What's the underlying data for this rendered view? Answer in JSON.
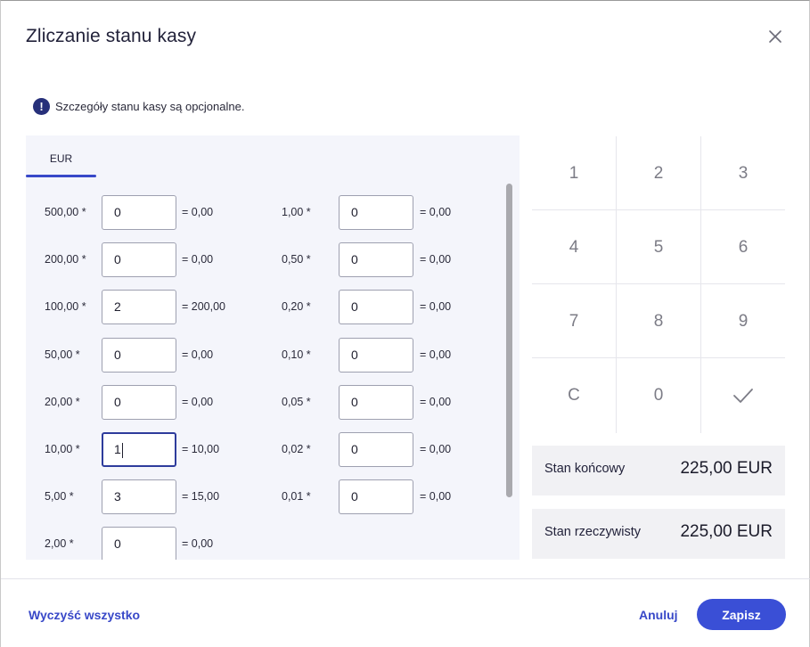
{
  "dialog": {
    "title": "Zliczanie stanu kasy",
    "info_text": "Szczegóły stanu kasy są opcjonalne."
  },
  "tabs": [
    {
      "label": "EUR",
      "active": true
    }
  ],
  "denominations_left": [
    {
      "label": "500,00 *",
      "value": "0",
      "result": "= 0,00"
    },
    {
      "label": "200,00 *",
      "value": "0",
      "result": "= 0,00"
    },
    {
      "label": "100,00 *",
      "value": "2",
      "result": "= 200,00"
    },
    {
      "label": "50,00 *",
      "value": "0",
      "result": "= 0,00"
    },
    {
      "label": "20,00 *",
      "value": "0",
      "result": "= 0,00"
    },
    {
      "label": "10,00 *",
      "value": "1",
      "result": "= 10,00",
      "focused": true
    },
    {
      "label": "5,00 *",
      "value": "3",
      "result": "= 15,00"
    },
    {
      "label": "2,00 *",
      "value": "0",
      "result": "= 0,00"
    }
  ],
  "denominations_right": [
    {
      "label": "1,00 *",
      "value": "0",
      "result": "= 0,00"
    },
    {
      "label": "0,50 *",
      "value": "0",
      "result": "= 0,00"
    },
    {
      "label": "0,20 *",
      "value": "0",
      "result": "= 0,00"
    },
    {
      "label": "0,10 *",
      "value": "0",
      "result": "= 0,00"
    },
    {
      "label": "0,05 *",
      "value": "0",
      "result": "= 0,00"
    },
    {
      "label": "0,02 *",
      "value": "0",
      "result": "= 0,00"
    },
    {
      "label": "0,01 *",
      "value": "0",
      "result": "= 0,00"
    }
  ],
  "keypad": {
    "keys": [
      "1",
      "2",
      "3",
      "4",
      "5",
      "6",
      "7",
      "8",
      "9",
      "C",
      "0",
      "check-icon"
    ]
  },
  "summary": {
    "end_label": "Stan końcowy",
    "end_value": "225,00 EUR",
    "actual_label": "Stan rzeczywisty",
    "actual_value": "225,00 EUR"
  },
  "footer": {
    "clear_all": "Wyczyść wszystko",
    "cancel": "Anuluj",
    "save": "Zapisz"
  },
  "colors": {
    "accent": "#3a4fd6",
    "info_icon": "#27307a",
    "panel_bg": "#f4f5fb"
  }
}
